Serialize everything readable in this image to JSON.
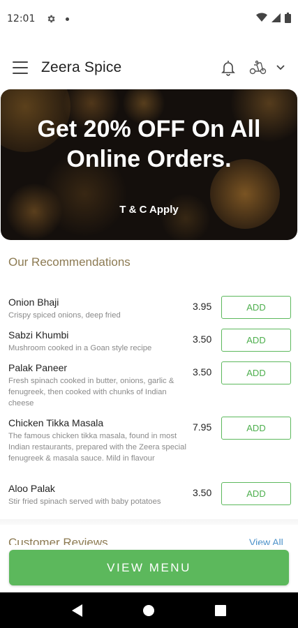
{
  "status_bar": {
    "time": "12:01",
    "icons": [
      "gear-icon",
      "notification-dot",
      "wifi-icon",
      "signal-icon",
      "battery-icon"
    ]
  },
  "app_bar": {
    "title": "Zeera Spice",
    "icons": [
      "hamburger-menu-icon",
      "bell-icon",
      "delivery-scooter-icon",
      "chevron-down-icon"
    ]
  },
  "banner": {
    "headline_line1": "Get 20% OFF On All",
    "headline_line2": "Online Orders.",
    "terms": "T & C Apply"
  },
  "recommendations": {
    "title": "Our Recommendations",
    "add_label": "ADD",
    "items": [
      {
        "name": "Onion Bhaji",
        "description": "Crispy spiced onions, deep fried",
        "price": "3.95"
      },
      {
        "name": "Sabzi Khumbi",
        "description": "Mushroom cooked in a Goan style recipe",
        "price": "3.50"
      },
      {
        "name": "Palak Paneer",
        "description": "Fresh spinach cooked in butter, onions, garlic & fenugreek, then cooked with chunks of Indian cheese",
        "price": "3.50"
      },
      {
        "name": "Chicken Tikka Masala",
        "description": "The famous chicken tikka masala, found in most Indian restaurants, prepared with the Zeera special fenugreek & masala sauce. Mild in flavour",
        "price": "7.95"
      },
      {
        "name": "Aloo Palak",
        "description": "Stir fried spinach served with baby potatoes",
        "price": "3.50"
      }
    ]
  },
  "reviews": {
    "title": "Customer Reviews",
    "view_all": "View All"
  },
  "view_menu_label": "VIEW MENU",
  "colors": {
    "accent_green": "#5cb85c",
    "section_title": "#8c7a52",
    "link_blue": "#4a90c8"
  }
}
